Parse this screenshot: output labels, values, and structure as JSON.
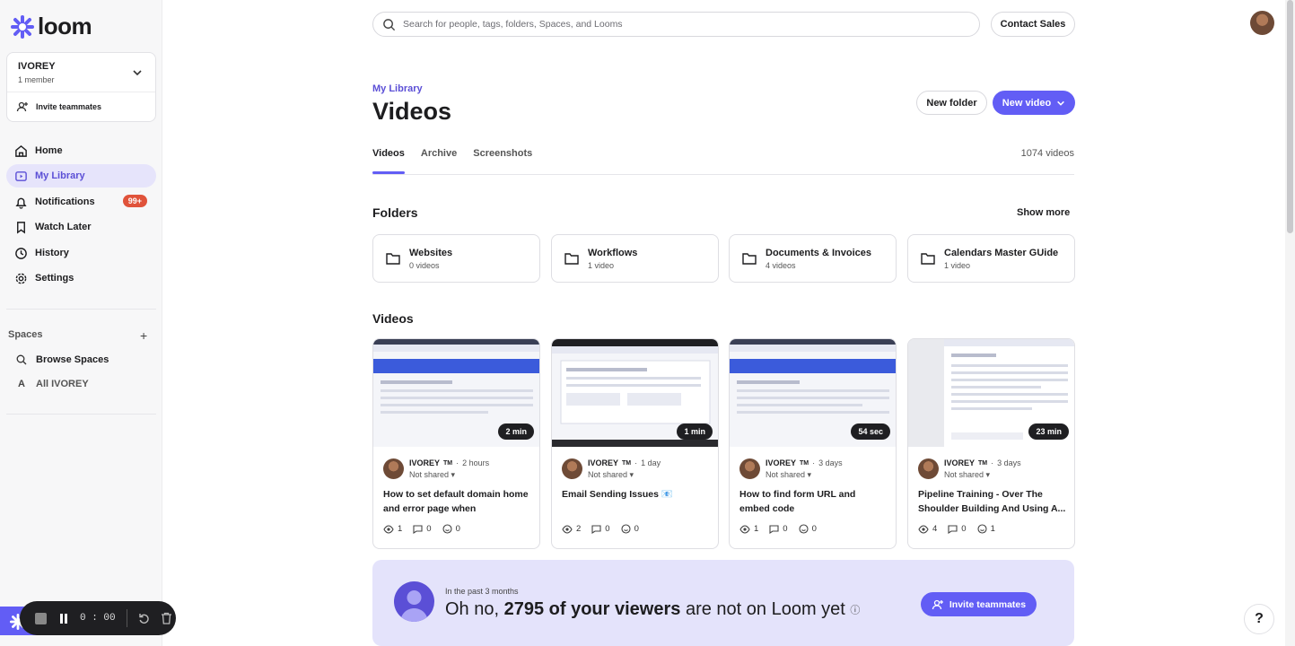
{
  "brand": {
    "name": "loom",
    "accent": "#625df5",
    "badge_color": "#e0533b"
  },
  "workspace": {
    "name": "IVOREY",
    "members": "1 member",
    "invite": "Invite teammates"
  },
  "nav": [
    {
      "label": "Home",
      "icon": "home-icon"
    },
    {
      "label": "My Library",
      "icon": "library-icon",
      "active": true
    },
    {
      "label": "Notifications",
      "icon": "bell-icon",
      "badge": "99+"
    },
    {
      "label": "Watch Later",
      "icon": "bookmark-icon"
    },
    {
      "label": "History",
      "icon": "clock-icon"
    },
    {
      "label": "Settings",
      "icon": "gear-icon"
    }
  ],
  "spaces": {
    "title": "Spaces",
    "browse": "Browse Spaces",
    "all_letter": "A",
    "all": "All IVOREY"
  },
  "recorder": {
    "time": "0 : 00"
  },
  "search": {
    "placeholder": "Search for people, tags, folders, Spaces, and Looms"
  },
  "header": {
    "contact": "Contact Sales"
  },
  "page": {
    "breadcrumb": "My Library",
    "title": "Videos",
    "new_folder": "New folder",
    "new_video": "New video"
  },
  "tabs": [
    "Videos",
    "Archive",
    "Screenshots"
  ],
  "video_count": "1074 videos",
  "folders_section": {
    "title": "Folders",
    "show_more": "Show more"
  },
  "folders": [
    {
      "name": "Websites",
      "count": "0 videos"
    },
    {
      "name": "Workflows",
      "count": "1 video"
    },
    {
      "name": "Documents & Invoices",
      "count": "4 videos"
    },
    {
      "name": "Calendars Master GUide",
      "count": "1 video"
    }
  ],
  "videos_section": {
    "title": "Videos"
  },
  "videos": [
    {
      "duration": "2 min",
      "owner": "IVOREY",
      "tag": "TM",
      "ago": "2 hours",
      "shared": "Not shared",
      "title": "How to set default domain home and error page when somebody...",
      "views": "1",
      "comments": "0",
      "reactions": "0"
    },
    {
      "duration": "1 min",
      "owner": "IVOREY",
      "tag": "TM",
      "ago": "1 day",
      "shared": "Not shared",
      "title": "Email Sending Issues 📧",
      "views": "2",
      "comments": "0",
      "reactions": "0"
    },
    {
      "duration": "54 sec",
      "owner": "IVOREY",
      "tag": "TM",
      "ago": "3 days",
      "shared": "Not shared",
      "title": "How to find form URL and embed code",
      "views": "1",
      "comments": "0",
      "reactions": "0"
    },
    {
      "duration": "23 min",
      "owner": "IVOREY",
      "tag": "TM",
      "ago": "3 days",
      "shared": "Not shared",
      "title": "Pipeline Training - Over The Shoulder Building And Using A...",
      "views": "4",
      "comments": "0",
      "reactions": "1"
    }
  ],
  "banner": {
    "small": "In the past 3 months",
    "pre": "Oh no,",
    "bold": "2795 of your viewers",
    "post": "are not on Loom yet",
    "button": "Invite teammates"
  },
  "help": "?"
}
